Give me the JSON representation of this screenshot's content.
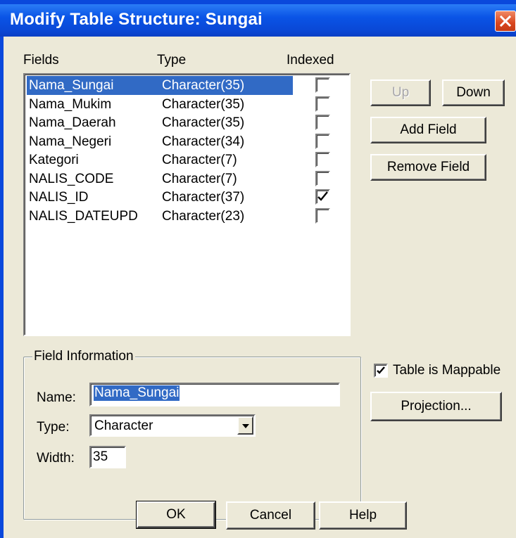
{
  "window": {
    "title": "Modify Table Structure: Sungai",
    "close_icon": "close-icon"
  },
  "fields_list": {
    "headers": {
      "fields": "Fields",
      "type": "Type",
      "indexed": "Indexed"
    },
    "rows": [
      {
        "name": "Nama_Sungai",
        "type": "Character(35)",
        "indexed": false,
        "selected": true
      },
      {
        "name": "Nama_Mukim",
        "type": "Character(35)",
        "indexed": false,
        "selected": false
      },
      {
        "name": "Nama_Daerah",
        "type": "Character(35)",
        "indexed": false,
        "selected": false
      },
      {
        "name": "Nama_Negeri",
        "type": "Character(34)",
        "indexed": false,
        "selected": false
      },
      {
        "name": "Kategori",
        "type": "Character(7)",
        "indexed": false,
        "selected": false
      },
      {
        "name": "NALIS_CODE",
        "type": "Character(7)",
        "indexed": false,
        "selected": false
      },
      {
        "name": "NALIS_ID",
        "type": "Character(37)",
        "indexed": true,
        "selected": false
      },
      {
        "name": "NALIS_DATEUPD",
        "type": "Character(23)",
        "indexed": false,
        "selected": false
      }
    ]
  },
  "side_buttons": {
    "up": "Up",
    "down": "Down",
    "add_field": "Add Field",
    "remove_field": "Remove Field"
  },
  "field_info": {
    "group_title": "Field Information",
    "name_label": "Name:",
    "name_value": "Nama_Sungai",
    "type_label": "Type:",
    "type_value": "Character",
    "width_label": "Width:",
    "width_value": "35"
  },
  "mappable": {
    "label": "Table is Mappable",
    "checked": true
  },
  "projection_button": "Projection...",
  "footer_buttons": {
    "ok": "OK",
    "cancel": "Cancel",
    "help": "Help"
  },
  "colors": {
    "titlebar": "#0a54e6",
    "dialog_bg": "#ece9d8",
    "selection": "#316ac5",
    "close_button": "#d9461e"
  }
}
